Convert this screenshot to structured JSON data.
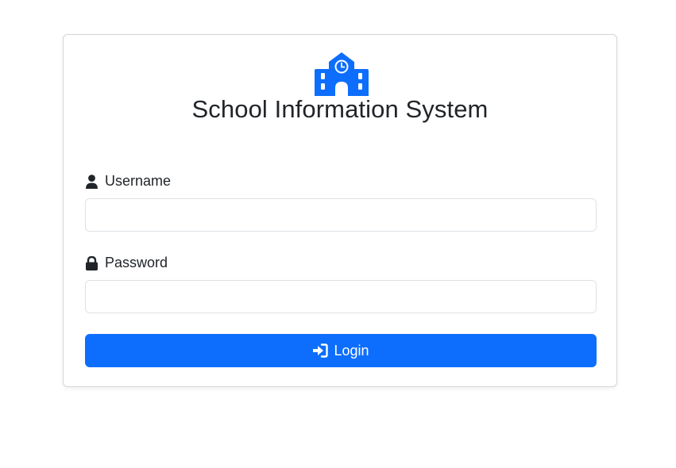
{
  "app": {
    "title": "School Information System",
    "logo_icon": "school-icon",
    "accent_color": "#0d6efd"
  },
  "form": {
    "username": {
      "label": "Username",
      "icon": "user-icon",
      "value": "",
      "placeholder": ""
    },
    "password": {
      "label": "Password",
      "icon": "lock-icon",
      "value": "",
      "placeholder": ""
    },
    "submit": {
      "label": "Login",
      "icon": "sign-in-icon"
    }
  }
}
